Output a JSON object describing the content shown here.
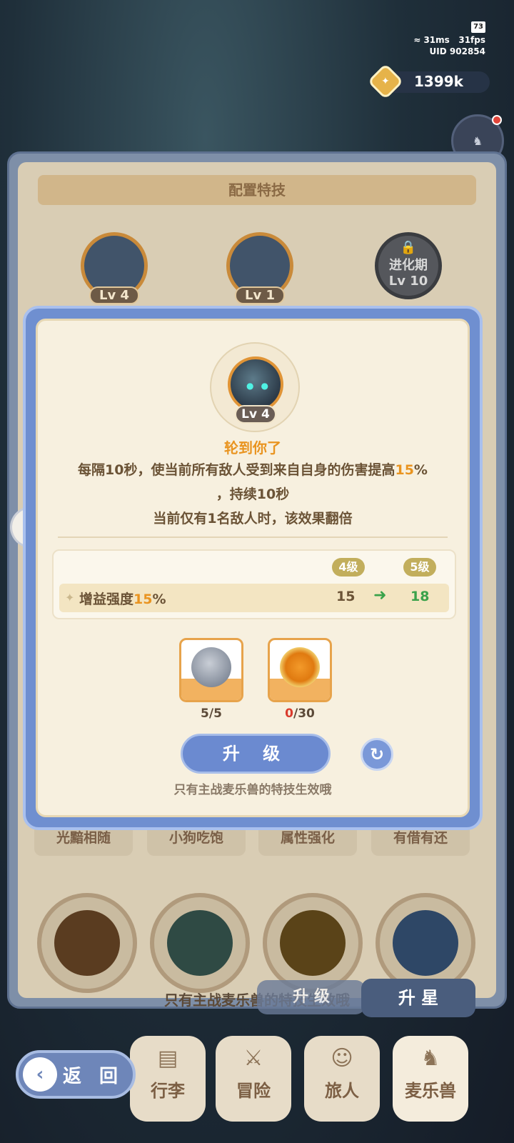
{
  "status": {
    "battery": "73",
    "ping": "31ms",
    "fps": "31fps",
    "uid": "UID 902854"
  },
  "currency": {
    "value": "1399k",
    "icon": "coin-icon"
  },
  "back_panel": {
    "title": "配置特技",
    "slots": [
      {
        "level": "Lv 4"
      },
      {
        "level": "Lv 1"
      },
      {
        "lock_label": "进化期",
        "lock_level": "Lv 10"
      }
    ],
    "tabs": [
      "光黯相随",
      "小狗吃饱",
      "属性强化",
      "有借有还"
    ],
    "bottom_text": "只有主战麦乐兽的特技生效哦",
    "upgrade_label": "升 级",
    "star_label": "升 星"
  },
  "modal": {
    "level_badge": "Lv 4",
    "skill_name": "轮到你了",
    "desc_line1_pre": "每隔10秒，使当前所有敌人受到来自自身的伤害提高",
    "desc_line1_hl": "15",
    "desc_line1_post": "%",
    "desc_line2": "，持续10秒",
    "desc_line3": "当前仅有1名敌人时，该效果翻倍",
    "table": {
      "current_level": "4级",
      "next_level": "5级",
      "row_label_pre": "增益强度",
      "row_label_hl": "15",
      "row_label_post": "%",
      "current_value": "15",
      "next_value": "18"
    },
    "materials": [
      {
        "count_have": "5",
        "count_need": "/5"
      },
      {
        "count_have": "0",
        "count_need": "/30"
      }
    ],
    "upgrade_button": "升 级",
    "note": "只有主战麦乐兽的特技生效哦"
  },
  "nav": {
    "back": "返 回",
    "items": [
      "行李",
      "冒险",
      "旅人",
      "麦乐兽"
    ]
  }
}
